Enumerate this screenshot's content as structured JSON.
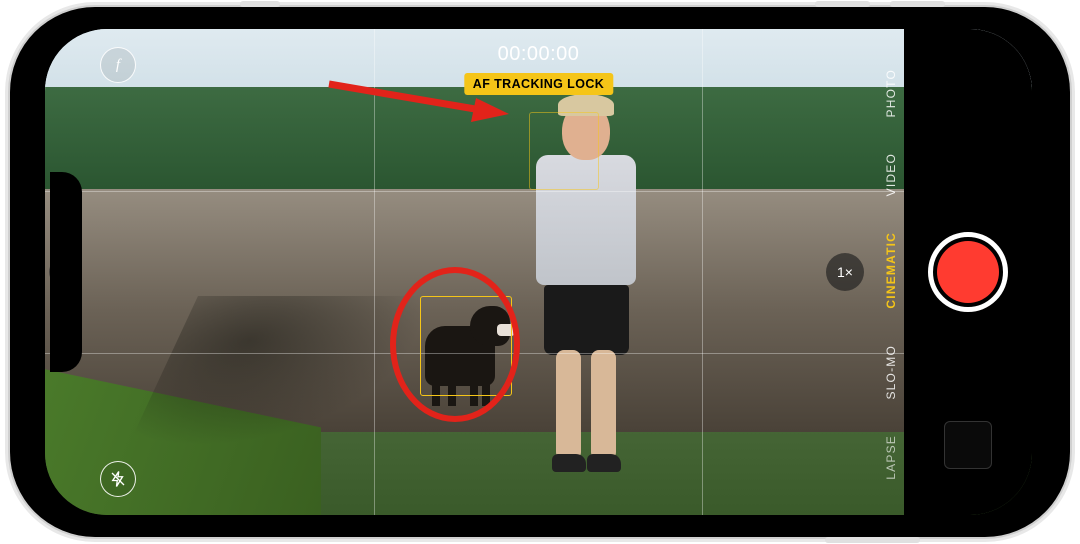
{
  "timer": "00:00:00",
  "af_badge": "AF TRACKING LOCK",
  "zoom": "1×",
  "fstop_label": "f",
  "modes": {
    "photo": "PHOTO",
    "video": "VIDEO",
    "cinematic": "CINEMATIC",
    "slomo": "SLO-MO",
    "timelapse": "LAPSE"
  },
  "active_mode": "cinematic",
  "colors": {
    "accent": "#f5c518",
    "record": "#ff3b30",
    "annotation": "#e2231a"
  }
}
